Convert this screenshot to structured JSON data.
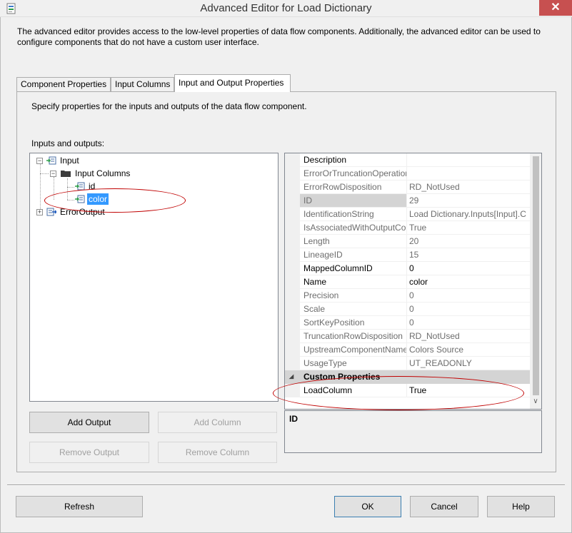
{
  "window": {
    "title": "Advanced Editor for Load Dictionary",
    "close_glyph": "✕"
  },
  "intro": "The advanced editor provides access to the low-level properties of data flow components. Additionally, the advanced editor can be used to configure components that do not have a custom user interface.",
  "tabs": [
    {
      "label": "Component Properties",
      "active": false
    },
    {
      "label": "Input Columns",
      "active": false
    },
    {
      "label": "Input and Output Properties",
      "active": true
    }
  ],
  "panel": {
    "description": "Specify properties for the inputs and outputs of the data flow component.",
    "io_label": "Inputs and outputs:"
  },
  "tree": {
    "input": "Input",
    "input_columns": "Input Columns",
    "col_id": "id",
    "col_color": "color",
    "error_output": "ErrorOutput",
    "selected": "color",
    "expand_glyph": "+",
    "collapse_glyph": "−"
  },
  "buttons": {
    "add_output": "Add Output",
    "add_column": "Add Column",
    "remove_output": "Remove Output",
    "remove_column": "Remove Column"
  },
  "properties": [
    {
      "name": "Description",
      "value": "",
      "readonly": false
    },
    {
      "name": "ErrorOrTruncationOperation",
      "value": "",
      "readonly": true
    },
    {
      "name": "ErrorRowDisposition",
      "value": "RD_NotUsed",
      "readonly": true
    },
    {
      "name": "ID",
      "value": "29",
      "readonly": true,
      "selected": true
    },
    {
      "name": "IdentificationString",
      "value": "Load Dictionary.Inputs[Input].C",
      "readonly": true
    },
    {
      "name": "IsAssociatedWithOutputColumn",
      "value": "True",
      "readonly": true
    },
    {
      "name": "Length",
      "value": "20",
      "readonly": true
    },
    {
      "name": "LineageID",
      "value": "15",
      "readonly": true
    },
    {
      "name": "MappedColumnID",
      "value": "0",
      "readonly": false
    },
    {
      "name": "Name",
      "value": "color",
      "readonly": false
    },
    {
      "name": "Precision",
      "value": "0",
      "readonly": true
    },
    {
      "name": "Scale",
      "value": "0",
      "readonly": true
    },
    {
      "name": "SortKeyPosition",
      "value": "0",
      "readonly": true
    },
    {
      "name": "TruncationRowDisposition",
      "value": "RD_NotUsed",
      "readonly": true
    },
    {
      "name": "UpstreamComponentName",
      "value": "Colors Source",
      "readonly": true
    },
    {
      "name": "UsageType",
      "value": "UT_READONLY",
      "readonly": true
    }
  ],
  "custom_category": {
    "label": "Custom Properties",
    "glyph": "◢"
  },
  "custom_properties": [
    {
      "name": "LoadColumn",
      "value": "True",
      "readonly": false
    }
  ],
  "scroll_down_glyph": "∨",
  "help": {
    "title": "ID"
  },
  "footer": {
    "refresh": "Refresh",
    "ok": "OK",
    "cancel": "Cancel",
    "help": "Help"
  },
  "annotation_color": "#c00000",
  "selection_color": "#3399ff"
}
